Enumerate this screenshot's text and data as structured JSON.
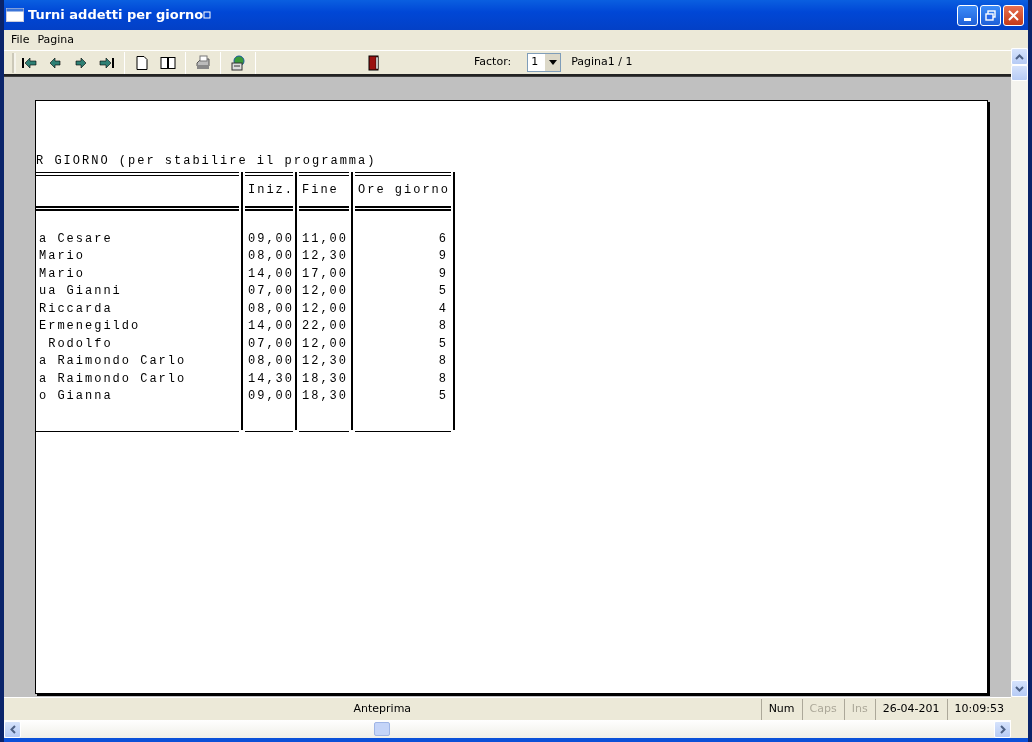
{
  "window": {
    "title": "Turni addetti per giorno"
  },
  "menu": [
    "File",
    "Pagina"
  ],
  "toolbar": {
    "factor_label": "Factor:",
    "factor_value": "1",
    "page_label": "Pagina1 / 1"
  },
  "report": {
    "heading": "R GIORNO (per stabilire il programma)",
    "columns": [
      "Iniz.",
      "Fine",
      "Ore giorno"
    ],
    "rows": [
      {
        "column_1": "a Cesare",
        "iniz": "09,00",
        "fine": "11,00",
        "ore_giorno": "6"
      },
      {
        "column_1": "Mario",
        "iniz": "08,00",
        "fine": "12,30",
        "ore_giorno": "9"
      },
      {
        "column_1": "Mario",
        "iniz": "14,00",
        "fine": "17,00",
        "ore_giorno": "9"
      },
      {
        "column_1": "ua Gianni",
        "iniz": "07,00",
        "fine": "12,00",
        "ore_giorno": "5"
      },
      {
        "column_1": "Riccarda",
        "iniz": "08,00",
        "fine": "12,00",
        "ore_giorno": "4"
      },
      {
        "column_1": "Ermenegildo",
        "iniz": "14,00",
        "fine": "22,00",
        "ore_giorno": "8"
      },
      {
        "column_1": " Rodolfo",
        "iniz": "07,00",
        "fine": "12,00",
        "ore_giorno": "5"
      },
      {
        "column_1": "a Raimondo Carlo",
        "iniz": "08,00",
        "fine": "12,30",
        "ore_giorno": "8"
      },
      {
        "column_1": "a Raimondo Carlo",
        "iniz": "14,30",
        "fine": "18,30",
        "ore_giorno": "8"
      },
      {
        "column_1": "o Gianna",
        "iniz": "09,00",
        "fine": "18,30",
        "ore_giorno": "5"
      }
    ]
  },
  "status_bar": {
    "message": "Anteprima",
    "panels": [
      {
        "text": "Num",
        "disabled": false
      },
      {
        "text": "Caps",
        "disabled": true
      },
      {
        "text": "Ins",
        "disabled": true
      },
      {
        "text": "26-04-201",
        "disabled": false
      },
      {
        "text": "10:09:53",
        "disabled": false
      }
    ]
  }
}
